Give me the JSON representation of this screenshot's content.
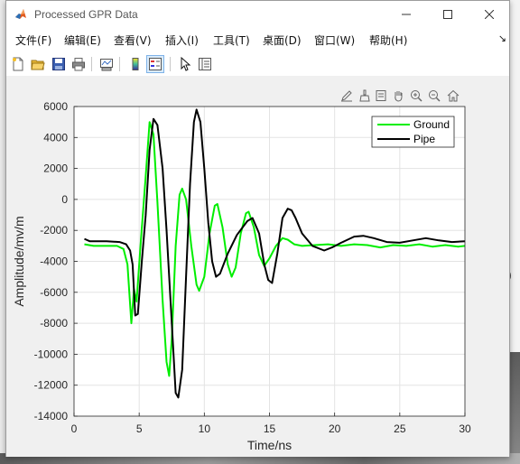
{
  "window": {
    "title": "Processed GPR Data",
    "controls": [
      "minimize",
      "maximize",
      "close"
    ]
  },
  "menu": [
    "文件(F)",
    "编辑(E)",
    "查看(V)",
    "插入(I)",
    "工具(T)",
    "桌面(D)",
    "窗口(W)",
    "帮助(H)"
  ],
  "toolbar": {
    "icons": [
      "new-figure-icon",
      "open-file-icon",
      "save-icon",
      "print-icon",
      "link-plot-icon",
      "colorbar-icon",
      "legend-icon",
      "select-arrow-icon",
      "property-inspector-icon"
    ]
  },
  "axes_toolbar": {
    "icons": [
      "edit-plot-icon",
      "brush-icon",
      "data-tips-icon",
      "pan-icon",
      "zoom-in-icon",
      "zoom-out-icon",
      "home-icon"
    ]
  },
  "colors": {
    "ground": "#00ee00",
    "pipe": "#000000"
  },
  "chart_data": {
    "type": "line",
    "title": "",
    "xlabel": "Time/ns",
    "ylabel": "Amplitude/mv/m",
    "xlim": [
      0,
      30
    ],
    "ylim": [
      -14000,
      6000
    ],
    "xticks": [
      0,
      5,
      10,
      15,
      20,
      25,
      30
    ],
    "yticks": [
      6000,
      4000,
      2000,
      0,
      -2000,
      -4000,
      -6000,
      -8000,
      -10000,
      -12000,
      -14000
    ],
    "grid": true,
    "legend": {
      "position": "top-right",
      "entries": [
        "Ground",
        "Pipe"
      ]
    },
    "series": [
      {
        "name": "Ground",
        "color": "#00ee00",
        "points": [
          [
            0.8,
            -2900
          ],
          [
            1.5,
            -3000
          ],
          [
            2.5,
            -3000
          ],
          [
            3.3,
            -3000
          ],
          [
            3.8,
            -3200
          ],
          [
            4.1,
            -4200
          ],
          [
            4.4,
            -8000
          ],
          [
            4.6,
            -5800
          ],
          [
            4.8,
            -6600
          ],
          [
            5.1,
            -3000
          ],
          [
            5.5,
            1500
          ],
          [
            5.8,
            5000
          ],
          [
            6.1,
            4200
          ],
          [
            6.4,
            -200
          ],
          [
            6.8,
            -6500
          ],
          [
            7.1,
            -10500
          ],
          [
            7.3,
            -11400
          ],
          [
            7.5,
            -9000
          ],
          [
            7.8,
            -3000
          ],
          [
            8.1,
            300
          ],
          [
            8.3,
            700
          ],
          [
            8.6,
            0
          ],
          [
            9.0,
            -3000
          ],
          [
            9.4,
            -5500
          ],
          [
            9.6,
            -5900
          ],
          [
            10.0,
            -5000
          ],
          [
            10.4,
            -2200
          ],
          [
            10.8,
            -400
          ],
          [
            11.0,
            -300
          ],
          [
            11.4,
            -1800
          ],
          [
            11.8,
            -4200
          ],
          [
            12.1,
            -5000
          ],
          [
            12.4,
            -4400
          ],
          [
            12.8,
            -2200
          ],
          [
            13.2,
            -900
          ],
          [
            13.4,
            -800
          ],
          [
            13.8,
            -1800
          ],
          [
            14.2,
            -3600
          ],
          [
            14.6,
            -4300
          ],
          [
            15.0,
            -3800
          ],
          [
            15.5,
            -3000
          ],
          [
            16.0,
            -2500
          ],
          [
            16.4,
            -2600
          ],
          [
            16.9,
            -2900
          ],
          [
            17.5,
            -3000
          ],
          [
            18.5,
            -2950
          ],
          [
            19.5,
            -2900
          ],
          [
            20.5,
            -3000
          ],
          [
            21.5,
            -2900
          ],
          [
            22.5,
            -2950
          ],
          [
            23.5,
            -3100
          ],
          [
            24.5,
            -2950
          ],
          [
            25.5,
            -3000
          ],
          [
            26.5,
            -2900
          ],
          [
            27.5,
            -3050
          ],
          [
            28.5,
            -2950
          ],
          [
            29.5,
            -3050
          ],
          [
            30.0,
            -3000
          ]
        ]
      },
      {
        "name": "Pipe",
        "color": "#000000",
        "points": [
          [
            0.8,
            -2550
          ],
          [
            1.2,
            -2700
          ],
          [
            2.5,
            -2700
          ],
          [
            3.5,
            -2750
          ],
          [
            4.0,
            -2900
          ],
          [
            4.3,
            -3300
          ],
          [
            4.5,
            -4200
          ],
          [
            4.7,
            -7500
          ],
          [
            4.9,
            -7400
          ],
          [
            5.2,
            -4000
          ],
          [
            5.5,
            -1000
          ],
          [
            5.8,
            3200
          ],
          [
            6.1,
            5200
          ],
          [
            6.4,
            4800
          ],
          [
            6.8,
            2000
          ],
          [
            7.1,
            -2000
          ],
          [
            7.5,
            -8000
          ],
          [
            7.8,
            -12500
          ],
          [
            8.0,
            -12800
          ],
          [
            8.3,
            -11000
          ],
          [
            8.6,
            -5000
          ],
          [
            8.9,
            1000
          ],
          [
            9.2,
            5000
          ],
          [
            9.4,
            5800
          ],
          [
            9.7,
            5000
          ],
          [
            10.0,
            2000
          ],
          [
            10.3,
            -1500
          ],
          [
            10.6,
            -4000
          ],
          [
            10.9,
            -5000
          ],
          [
            11.2,
            -4800
          ],
          [
            11.8,
            -3500
          ],
          [
            12.5,
            -2300
          ],
          [
            13.3,
            -1400
          ],
          [
            13.7,
            -1200
          ],
          [
            14.2,
            -2200
          ],
          [
            14.6,
            -4200
          ],
          [
            14.9,
            -5200
          ],
          [
            15.2,
            -5400
          ],
          [
            15.6,
            -3500
          ],
          [
            16.0,
            -1200
          ],
          [
            16.4,
            -600
          ],
          [
            16.7,
            -700
          ],
          [
            17.0,
            -1200
          ],
          [
            17.5,
            -2200
          ],
          [
            18.3,
            -3000
          ],
          [
            19.2,
            -3300
          ],
          [
            19.8,
            -3100
          ],
          [
            20.5,
            -2800
          ],
          [
            21.5,
            -2400
          ],
          [
            22.2,
            -2350
          ],
          [
            23.0,
            -2500
          ],
          [
            24.0,
            -2750
          ],
          [
            25.0,
            -2800
          ],
          [
            26.0,
            -2650
          ],
          [
            27.0,
            -2500
          ],
          [
            28.0,
            -2650
          ],
          [
            29.0,
            -2750
          ],
          [
            30.0,
            -2700
          ]
        ]
      }
    ]
  }
}
